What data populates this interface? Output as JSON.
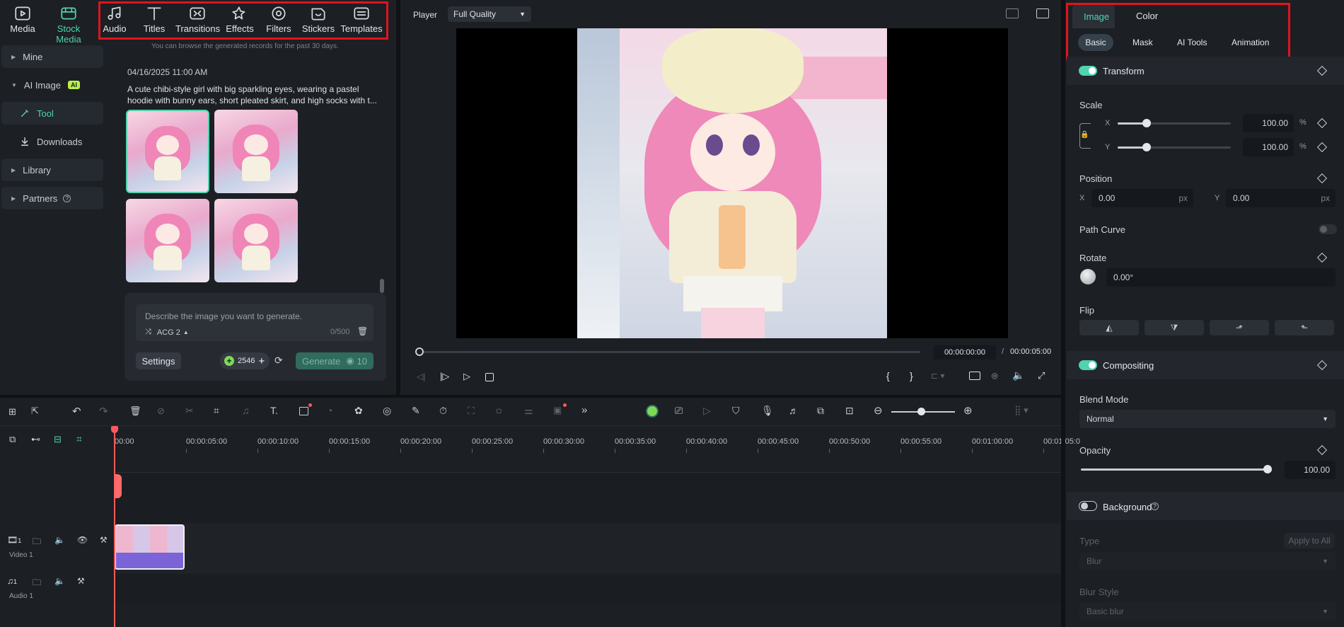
{
  "top_nav": {
    "items": [
      {
        "label": "Media",
        "icon": "media-icon"
      },
      {
        "label": "Stock Media",
        "icon": "stock-media-icon",
        "active": true
      },
      {
        "label": "Audio",
        "icon": "music-note-icon"
      },
      {
        "label": "Titles",
        "icon": "title-t-icon"
      },
      {
        "label": "Transitions",
        "icon": "transitions-icon"
      },
      {
        "label": "Effects",
        "icon": "effects-star-icon"
      },
      {
        "label": "Filters",
        "icon": "filters-icon"
      },
      {
        "label": "Stickers",
        "icon": "stickers-icon"
      },
      {
        "label": "Templates",
        "icon": "templates-icon"
      }
    ]
  },
  "sidebar": {
    "items": [
      {
        "label": "Mine"
      },
      {
        "label": "AI Image",
        "badge": "AI"
      },
      {
        "label": "Tool"
      },
      {
        "label": "Downloads"
      },
      {
        "label": "Library"
      },
      {
        "label": "Partners"
      }
    ]
  },
  "generator": {
    "notice": "You can browse the generated records for the past 30 days.",
    "timestamp": "04/16/2025 11:00 AM",
    "prompt_text": "A cute chibi-style girl with big sparkling eyes, wearing a pastel hoodie with bunny ears, short pleated skirt, and high socks with t...",
    "input_placeholder": "Describe the image you want to generate.",
    "model": "ACG 2",
    "char_count": "0/500",
    "settings_label": "Settings",
    "credits": "2546",
    "generate_label": "Generate",
    "generate_cost": "10"
  },
  "player": {
    "label": "Player",
    "quality": "Full Quality",
    "current_time": "00:00:00:00",
    "separator": "/",
    "total_time": "00:00:05:00"
  },
  "right_panel": {
    "tabs": [
      {
        "label": "Image",
        "active": true
      },
      {
        "label": "Color"
      }
    ],
    "subtabs": [
      {
        "label": "Basic",
        "active": true
      },
      {
        "label": "Mask"
      },
      {
        "label": "AI Tools"
      },
      {
        "label": "Animation"
      }
    ],
    "transform": {
      "title": "Transform",
      "scale_label": "Scale",
      "scale_x": {
        "axis": "X",
        "value": "100.00",
        "unit": "%"
      },
      "scale_y": {
        "axis": "Y",
        "value": "100.00",
        "unit": "%"
      },
      "position_label": "Position",
      "pos_x": {
        "axis": "X",
        "value": "0.00",
        "unit": "px"
      },
      "pos_y": {
        "axis": "Y",
        "value": "0.00",
        "unit": "px"
      },
      "path_curve_label": "Path Curve",
      "rotate_label": "Rotate",
      "rotate_value": "0.00°",
      "flip_label": "Flip"
    },
    "compositing": {
      "title": "Compositing",
      "blend_label": "Blend Mode",
      "blend_value": "Normal",
      "opacity_label": "Opacity",
      "opacity_value": "100.00"
    },
    "background": {
      "title": "Background",
      "type_label": "Type",
      "apply_all": "Apply to All",
      "type_value": "Blur",
      "blur_style_label": "Blur Style",
      "blur_style_value": "Basic blur"
    }
  },
  "timeline": {
    "ticks": [
      "00:00",
      "00:00:05:00",
      "00:00:10:00",
      "00:00:15:00",
      "00:00:20:00",
      "00:00:25:00",
      "00:00:30:00",
      "00:00:35:00",
      "00:00:40:00",
      "00:00:45:00",
      "00:00:50:00",
      "00:00:55:00",
      "00:01:00:00",
      "00:01:05:0"
    ],
    "video_track": {
      "number": "1",
      "name": "Video 1"
    },
    "audio_track": {
      "number": "1",
      "name": "Audio 1"
    }
  },
  "colors": {
    "accent": "#4fd3b0",
    "highlight_box": "#e0141e",
    "clip": "#7b63d8",
    "playhead": "#ff5a5a"
  }
}
